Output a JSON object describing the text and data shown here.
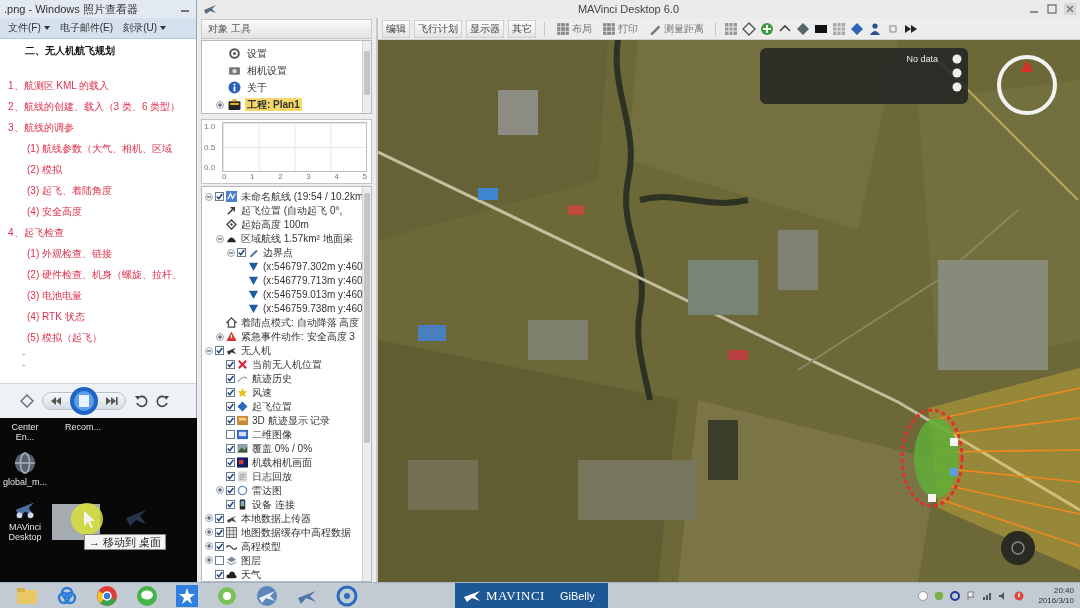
{
  "photo_viewer": {
    "title": ".png - Windows 照片查看器",
    "menu": [
      {
        "label": "文件(F)",
        "dropdown": true
      },
      {
        "label": "电子邮件(E)",
        "dropdown": false
      },
      {
        "label": "刻录(U)",
        "dropdown": true
      }
    ],
    "document": {
      "heading": "二、无人机航飞规划",
      "lines": [
        {
          "kind": "step",
          "text": "1、航测区 KML 的载入"
        },
        {
          "kind": "step",
          "text": "2、航线的创建、载入（3 类、6 类型）"
        },
        {
          "kind": "step",
          "text": "3、航线的调参"
        },
        {
          "kind": "sub",
          "text": "(1) 航线参数（大气、相机、区域"
        },
        {
          "kind": "sub",
          "text": "(2) 模拟"
        },
        {
          "kind": "sub",
          "text": "(3) 起飞、着陆角度"
        },
        {
          "kind": "sub",
          "text": "(4) 安全高度"
        },
        {
          "kind": "step",
          "text": "4、起飞检查"
        },
        {
          "kind": "sub",
          "text": "(1) 外观检查、链接"
        },
        {
          "kind": "sub",
          "text": "(2) 硬件检查、机身（螺旋、拉杆、"
        },
        {
          "kind": "sub",
          "text": "(3) 电池电量"
        },
        {
          "kind": "sub",
          "text": "(4) RTK 状态"
        },
        {
          "kind": "sub",
          "text": "(5) 模拟（起飞）"
        },
        {
          "kind": "mark",
          "text": "-"
        },
        {
          "kind": "mark",
          "text": "-"
        }
      ]
    }
  },
  "desktop": {
    "icon_rows": [
      [
        {
          "label": "Center En...",
          "kind": "cut"
        },
        {
          "label": "Recom...",
          "kind": "cut"
        }
      ],
      [
        {
          "label": "global_m...",
          "kind": "globe"
        }
      ],
      [
        {
          "label": "MAVinci Desktop",
          "kind": "plane"
        }
      ]
    ],
    "drag_tooltip": "→ 移动到 桌面"
  },
  "mavinci": {
    "title": "MAVinci Desktop 6.0",
    "panel_header": "对象 工具",
    "settings_tree": [
      {
        "label": "设置",
        "kind": "gear",
        "selected": false
      },
      {
        "label": "相机设置",
        "kind": "camera",
        "selected": false
      },
      {
        "label": "关于",
        "kind": "info",
        "selected": false
      },
      {
        "label": "工程: Plan1",
        "kind": "project",
        "selected": true,
        "expanded": false
      }
    ],
    "profile_chart": {
      "y_labels": [
        "1.0",
        "0.5",
        "0.0"
      ],
      "x_labels": [
        "0",
        "1",
        "2",
        "3",
        "4",
        "5"
      ]
    },
    "tree": [
      {
        "label": "未命名航线 (19:54 / 10.2km",
        "kind": "plan",
        "checked": true,
        "expanded": true,
        "children": [
          {
            "label": "起飞位置 (自动起飞 0°,",
            "kind": "takeoff"
          },
          {
            "label": "起始高度 100m",
            "kind": "altitude"
          },
          {
            "label": "区域航线 1.57km² 地面采",
            "kind": "area",
            "expanded": true,
            "children": [
              {
                "label": "边界点",
                "kind": "points",
                "checked": true,
                "expanded": true,
                "children": [
                  {
                    "label": "(x:546797.302m y:460",
                    "kind": "point"
                  },
                  {
                    "label": "(x:546779.713m y:460",
                    "kind": "point"
                  },
                  {
                    "label": "(x:546759.013m y:460",
                    "kind": "point"
                  },
                  {
                    "label": "(x:546759.738m y:460",
                    "kind": "point"
                  }
                ]
              }
            ]
          },
          {
            "label": "着陆点模式: 自动降落 高度",
            "kind": "landing"
          },
          {
            "label": "紧急事件动作: 安全高度 3",
            "kind": "warning",
            "expanded": false
          }
        ]
      },
      {
        "label": "无人机",
        "kind": "uav",
        "checked": true,
        "expanded": true,
        "children": [
          {
            "label": "当前无人机位置",
            "kind": "position",
            "checked": true
          },
          {
            "label": "航迹历史",
            "kind": "track",
            "checked": true
          },
          {
            "label": "风速",
            "kind": "wind",
            "checked": true
          },
          {
            "label": "起飞位置",
            "kind": "home",
            "checked": true
          },
          {
            "label": "3D 航迹显示 记录",
            "kind": "path3d",
            "checked": true
          },
          {
            "label": "二维图像",
            "kind": "image2d",
            "checked": false
          },
          {
            "label": "覆盖 0% / 0%",
            "kind": "coverage",
            "checked": true
          },
          {
            "label": "机载相机画面",
            "kind": "camera2",
            "checked": true
          },
          {
            "label": "日志回放",
            "kind": "log",
            "checked": true
          },
          {
            "label": "雷达图",
            "kind": "radar",
            "checked": true,
            "expanded": false
          },
          {
            "label": "设备 连接",
            "kind": "device",
            "checked": true
          }
        ]
      },
      {
        "label": "本地数据上传器",
        "kind": "upload",
        "checked": true,
        "expanded": false
      },
      {
        "label": "地图数据缓存中高程数据",
        "kind": "cache",
        "checked": true,
        "expanded": false
      },
      {
        "label": "高程模型",
        "kind": "elevation",
        "checked": true,
        "expanded": false
      },
      {
        "label": "图层",
        "kind": "layers",
        "checked": false,
        "expanded": false
      },
      {
        "label": "天气",
        "kind": "weather",
        "checked": true
      }
    ],
    "toolbar": {
      "menus": [
        "编辑",
        "飞行计划",
        "显示器",
        "其它"
      ],
      "tools": [
        {
          "label": "布局",
          "kind": "grid"
        },
        {
          "label": "打印",
          "kind": "grid"
        },
        {
          "label": "测量距离",
          "kind": "pencil"
        }
      ]
    },
    "map": {
      "status_label": "No data"
    }
  },
  "taskbar": {
    "app_button": {
      "logo": "MAVINCI",
      "label": "GiBelly"
    },
    "clock": {
      "time": "20:40",
      "date": "2016/3/10"
    }
  }
}
